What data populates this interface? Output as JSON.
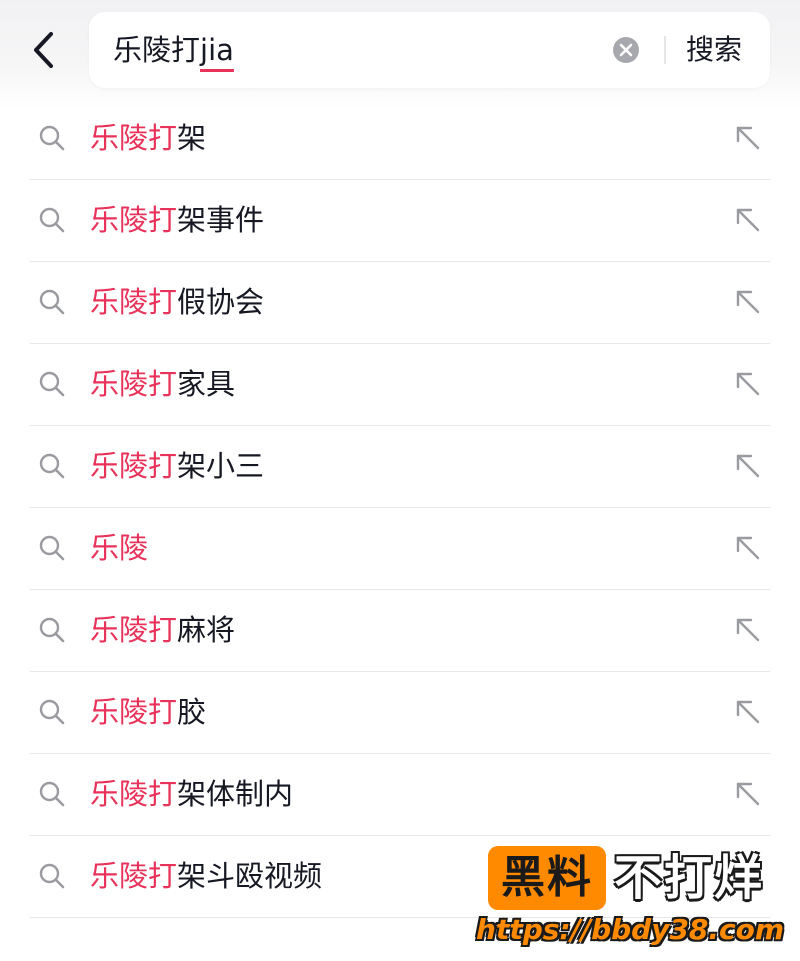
{
  "header": {
    "query_confirmed": "乐陵打",
    "query_composing": "jia",
    "search_button": "搜索"
  },
  "suggestions": [
    {
      "match": "乐陵打",
      "rest": "架",
      "arrow": true
    },
    {
      "match": "乐陵打",
      "rest": "架事件",
      "arrow": true
    },
    {
      "match": "乐陵打",
      "rest": "假协会",
      "arrow": true
    },
    {
      "match": "乐陵打",
      "rest": "家具",
      "arrow": true
    },
    {
      "match": "乐陵打",
      "rest": "架小三",
      "arrow": true
    },
    {
      "match": "乐陵",
      "rest": "",
      "arrow": true
    },
    {
      "match": "乐陵打",
      "rest": "麻将",
      "arrow": true
    },
    {
      "match": "乐陵打",
      "rest": "胶",
      "arrow": true
    },
    {
      "match": "乐陵打",
      "rest": "架体制内",
      "arrow": true
    },
    {
      "match": "乐陵打",
      "rest": "架斗殴视频",
      "arrow": false
    }
  ],
  "watermark": {
    "badge": "黑料",
    "tagline": "不打烊",
    "url": "https://bbdy38.com"
  },
  "colors": {
    "highlight": "#e8325a",
    "text": "#161823",
    "icon": "#9a9ba0",
    "watermark_orange": "#ff8a00"
  },
  "icons": {
    "back": "chevron-left-icon",
    "clear": "clear-circle-icon",
    "suggestion": "search-icon",
    "fill": "arrow-up-left-icon"
  }
}
